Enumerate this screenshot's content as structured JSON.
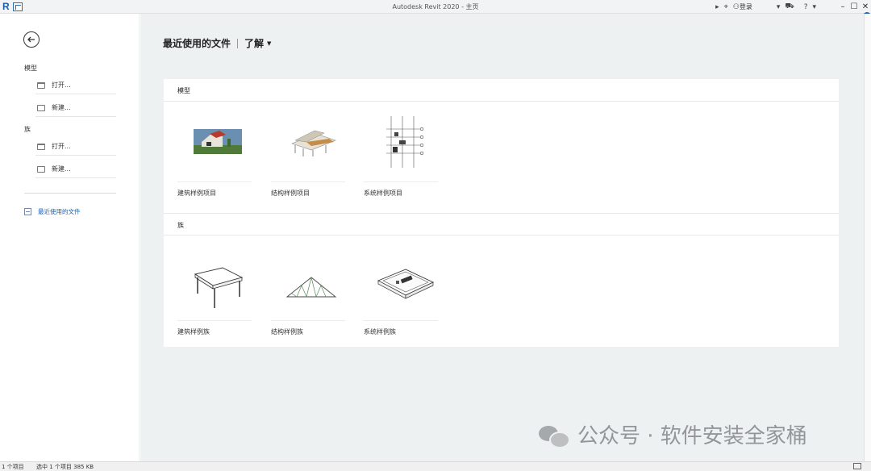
{
  "titlebar": {
    "app_logo": "R",
    "title": "Autodesk Revit 2020 - 主页",
    "login": "登录",
    "colors": {
      "accent": "#1b5fb0"
    }
  },
  "sidebar": {
    "model_heading": "模型",
    "model_open": "打开...",
    "model_new": "新建...",
    "family_heading": "族",
    "family_open": "打开...",
    "family_new": "新建...",
    "recent_files": "最近使用的文件"
  },
  "main": {
    "title": "最近使用的文件",
    "learn_tab": "了解"
  },
  "models": {
    "heading": "模型",
    "items": [
      {
        "label": "建筑样例项目",
        "icon": "house-render-thumbnail"
      },
      {
        "label": "结构样例项目",
        "icon": "structure-model-thumbnail"
      },
      {
        "label": "系统样例项目",
        "icon": "system-section-thumbnail"
      }
    ]
  },
  "families": {
    "heading": "族",
    "items": [
      {
        "label": "建筑样例族",
        "icon": "table-thumbnail"
      },
      {
        "label": "结构样例族",
        "icon": "truss-thumbnail"
      },
      {
        "label": "系统样例族",
        "icon": "tray-thumbnail"
      }
    ]
  },
  "watermark": {
    "text": "公众号 · 软件安装全家桶"
  },
  "statusbar": {
    "items": "1 个项目",
    "selected": "选中 1 个项目 385 KB"
  }
}
